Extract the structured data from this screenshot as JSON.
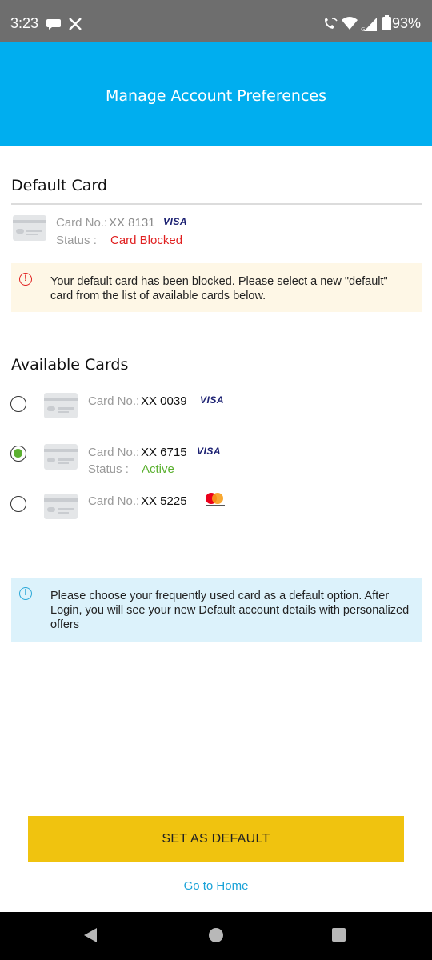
{
  "status_bar": {
    "time": "3:23",
    "battery": "93%",
    "icons": [
      "message-icon",
      "x-logo-icon",
      "wifi-calling-icon",
      "wifi-icon",
      "signal-icon",
      "battery-icon"
    ]
  },
  "header": {
    "title": "Manage Account Preferences",
    "background": "#00aeef"
  },
  "default_card": {
    "section_title": "Default Card",
    "card_no_label": "Card No.:",
    "card_no": "XX 8131",
    "network": "VISA",
    "status_label": "Status :",
    "status": "Card Blocked",
    "status_color": "#e02020"
  },
  "blocked_alert": {
    "icon": "exclamation-circle-icon",
    "text": "Your default card has been blocked. Please select a new \"default\" card from the list of available cards below."
  },
  "available_cards": {
    "section_title": "Available Cards",
    "cards": [
      {
        "card_no_label": "Card No.:",
        "card_no": "XX 0039",
        "network": "VISA",
        "selected": false
      },
      {
        "card_no_label": "Card No.:",
        "card_no": "XX 6715",
        "network": "VISA",
        "status_label": "Status :",
        "status": "Active",
        "selected": true
      },
      {
        "card_no_label": "Card No.:",
        "card_no": "XX 5225",
        "network": "mastercard",
        "selected": false
      }
    ]
  },
  "info_alert": {
    "icon": "info-circle-icon",
    "text": "Please choose your frequently used card as a default option. After Login, you will see your new Default account details with personalized offers"
  },
  "actions": {
    "set_default_label": "SET AS DEFAULT",
    "go_home_label": "Go to Home",
    "button_color": "#f0c30f"
  },
  "colors": {
    "accent": "#00aeef",
    "success": "#5bb030",
    "danger": "#e02020"
  }
}
